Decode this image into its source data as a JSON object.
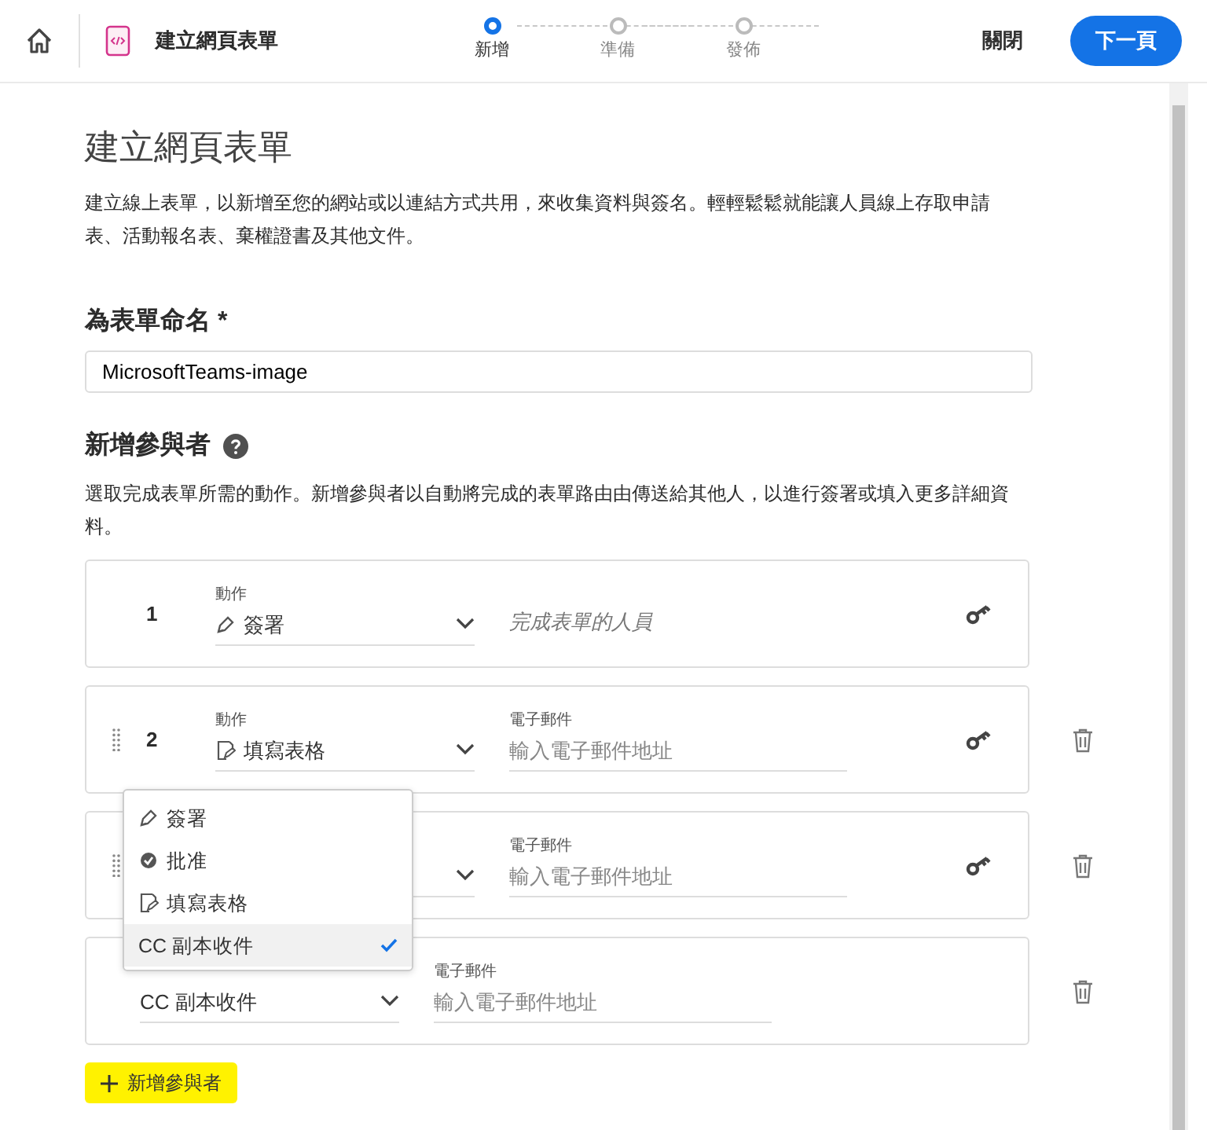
{
  "header": {
    "title": "建立網頁表單",
    "close": "關閉",
    "next": "下一頁",
    "steps": [
      {
        "label": "新增",
        "selected": true
      },
      {
        "label": "準備",
        "selected": false
      },
      {
        "label": "發佈",
        "selected": false
      }
    ]
  },
  "page": {
    "title": "建立網頁表單",
    "description": "建立線上表單，以新增至您的網站或以連結方式共用，來收集資料與簽名。輕輕鬆鬆就能讓人員線上存取申請表、活動報名表、棄權證書及其他文件。",
    "name_label": "為表單命名 *",
    "name_value": "MicrosoftTeams-image",
    "participants_heading": "新增參與者",
    "participants_description": "選取完成表單所需的動作。新增參與者以自動將完成的表單路由由傳送給其他人，以進行簽署或填入更多詳細資料。"
  },
  "participants": [
    {
      "kind": "signer",
      "number": "1",
      "draggable": false,
      "deletable": false,
      "has_key": true,
      "action_label": "動作",
      "action": {
        "kind": "sign",
        "text": "簽署"
      },
      "recipient": "完成表單的人員"
    },
    {
      "kind": "email",
      "number": "2",
      "draggable": true,
      "deletable": true,
      "has_key": true,
      "action_label": "動作",
      "action": {
        "kind": "fill",
        "text": "填寫表格"
      },
      "email_label": "電子郵件",
      "placeholder": "輸入電子郵件地址"
    },
    {
      "kind": "email",
      "draggable": true,
      "deletable": true,
      "has_key": true,
      "email_label": "電子郵件",
      "placeholder": "輸入電子郵件地址"
    },
    {
      "kind": "email",
      "draggable": false,
      "deletable": true,
      "has_key": false,
      "action": {
        "kind": "cc",
        "text": "CC 副本收件"
      },
      "email_label": "電子郵件",
      "placeholder": "輸入電子郵件地址"
    }
  ],
  "dropdown": {
    "options": [
      {
        "kind": "sign",
        "text": "簽署",
        "selected": false
      },
      {
        "kind": "approve",
        "text": "批准",
        "selected": false
      },
      {
        "kind": "fill",
        "text": "填寫表格",
        "selected": false
      },
      {
        "kind": "cc",
        "text": "CC 副本收件",
        "selected": true
      }
    ]
  },
  "add_button": "新增參與者"
}
